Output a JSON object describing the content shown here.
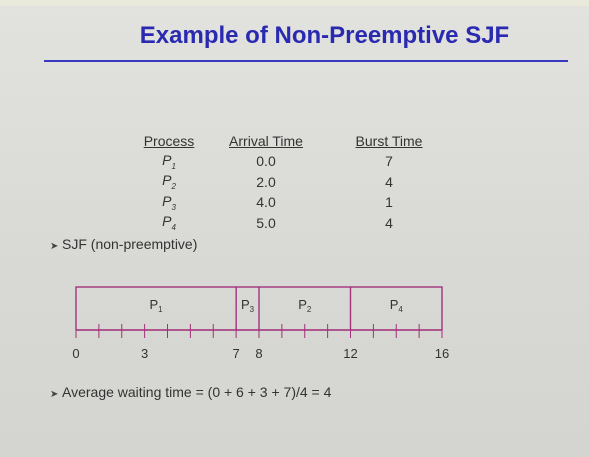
{
  "title": "Example of Non-Preemptive SJF",
  "table": {
    "headers": [
      "Process",
      "Arrival Time",
      "Burst Time"
    ],
    "rows": [
      {
        "process": "P",
        "sub": "1",
        "arrival": "0.0",
        "burst": "7"
      },
      {
        "process": "P",
        "sub": "2",
        "arrival": "2.0",
        "burst": "4"
      },
      {
        "process": "P",
        "sub": "3",
        "arrival": "4.0",
        "burst": "1"
      },
      {
        "process": "P",
        "sub": "4",
        "arrival": "5.0",
        "burst": "4"
      }
    ]
  },
  "bullets": {
    "algo": "SJF (non-preemptive)",
    "avg": "Average waiting time = (0 + 6 + 3 + 7)/4 = 4"
  },
  "gantt": {
    "start": 0,
    "end": 16,
    "blocks": [
      {
        "label": "P",
        "sub": "1",
        "start": 0,
        "end": 7
      },
      {
        "label": "P",
        "sub": "3",
        "start": 7,
        "end": 8
      },
      {
        "label": "P",
        "sub": "2",
        "start": 8,
        "end": 12
      },
      {
        "label": "P",
        "sub": "4",
        "start": 12,
        "end": 16
      }
    ],
    "tick_labels": [
      "0",
      "3",
      "7",
      "8",
      "12",
      "16"
    ],
    "tick_values": [
      0,
      3,
      7,
      8,
      12,
      16
    ]
  },
  "colors": {
    "title": "#2a2ab0",
    "rule": "#3a3ac0",
    "gantt": "#a0307a"
  }
}
